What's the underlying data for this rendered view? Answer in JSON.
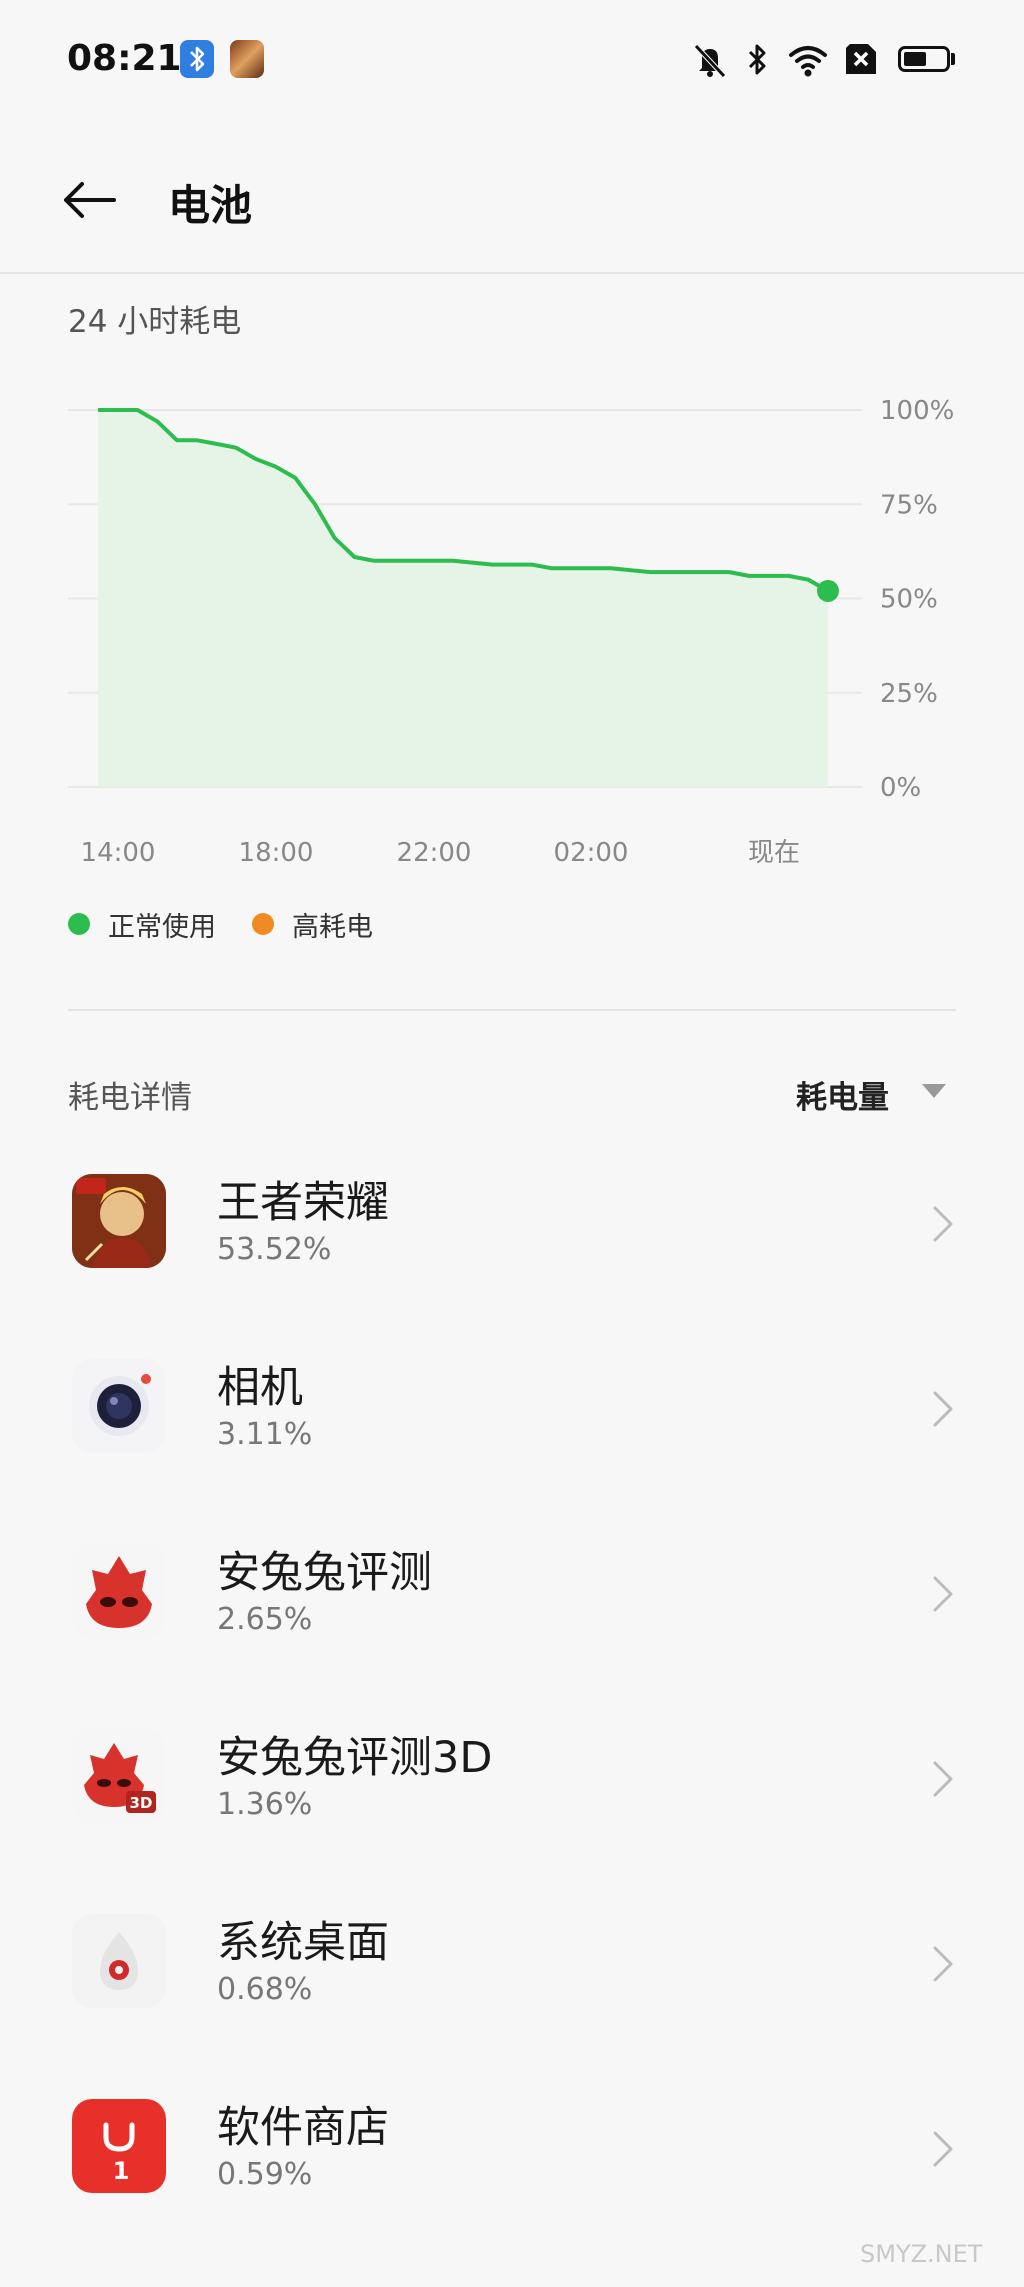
{
  "status_bar": {
    "time": "08:21",
    "left_icons": [
      "bluetooth-app-icon",
      "game-notification-icon"
    ],
    "right_icons": [
      "mute-icon",
      "bluetooth-icon",
      "wifi-icon",
      "no-sim-icon",
      "battery-icon"
    ],
    "battery_level": 0.55
  },
  "header": {
    "back_icon": "back-arrow-icon",
    "title": "电池"
  },
  "usage": {
    "section_title": "24 小时耗电"
  },
  "chart_data": {
    "type": "area",
    "x_tick_labels": [
      "14:00",
      "18:00",
      "22:00",
      "02:00",
      "现在"
    ],
    "y_tick_labels": [
      "100%",
      "75%",
      "50%",
      "25%",
      "0%"
    ],
    "ylim": [
      0,
      100
    ],
    "x_hours_range": [
      0,
      18.5
    ],
    "series": [
      {
        "name": "正常使用",
        "color": "#2dbd4e",
        "points": [
          [
            0.0,
            100
          ],
          [
            1.0,
            100
          ],
          [
            1.5,
            97
          ],
          [
            2.0,
            92
          ],
          [
            2.5,
            92
          ],
          [
            3.0,
            91
          ],
          [
            3.5,
            90
          ],
          [
            4.0,
            87
          ],
          [
            4.5,
            85
          ],
          [
            5.0,
            82
          ],
          [
            5.5,
            75
          ],
          [
            6.0,
            66
          ],
          [
            6.5,
            61
          ],
          [
            7.0,
            60
          ],
          [
            8.0,
            60
          ],
          [
            9.0,
            60
          ],
          [
            10.0,
            59
          ],
          [
            11.0,
            59
          ],
          [
            11.5,
            58
          ],
          [
            13.0,
            58
          ],
          [
            14.0,
            57
          ],
          [
            16.0,
            57
          ],
          [
            16.5,
            56
          ],
          [
            17.5,
            56
          ],
          [
            18.0,
            55
          ],
          [
            18.5,
            52
          ]
        ]
      }
    ],
    "legend": [
      {
        "label": "正常使用",
        "color": "#2dbd4e"
      },
      {
        "label": "高耗电",
        "color": "#f08a24"
      }
    ],
    "grid": true,
    "legend_position": "bottom-left"
  },
  "details": {
    "section_title": "耗电详情",
    "sort_label": "耗电量",
    "sort_icon": "chevron-down-icon",
    "row_chevron_icon": "chevron-right-icon",
    "apps": [
      {
        "name": "王者荣耀",
        "percent": "53.52%",
        "icon": "honor-of-kings-app-icon"
      },
      {
        "name": "相机",
        "percent": "3.11%",
        "icon": "camera-app-icon"
      },
      {
        "name": "安兔兔评测",
        "percent": "2.65%",
        "icon": "antutu-app-icon"
      },
      {
        "name": "安兔兔评测3D",
        "percent": "1.36%",
        "icon": "antutu-3d-app-icon"
      },
      {
        "name": "系统桌面",
        "percent": "0.68%",
        "icon": "system-launcher-app-icon"
      },
      {
        "name": "软件商店",
        "percent": "0.59%",
        "icon": "app-store-app-icon"
      }
    ]
  },
  "watermark": "SMYZ.NET",
  "colors": {
    "background": "#f7f7f7",
    "accent_green": "#2dbd4e",
    "accent_orange": "#f08a24",
    "chart_fill": "#e6f4e7"
  }
}
